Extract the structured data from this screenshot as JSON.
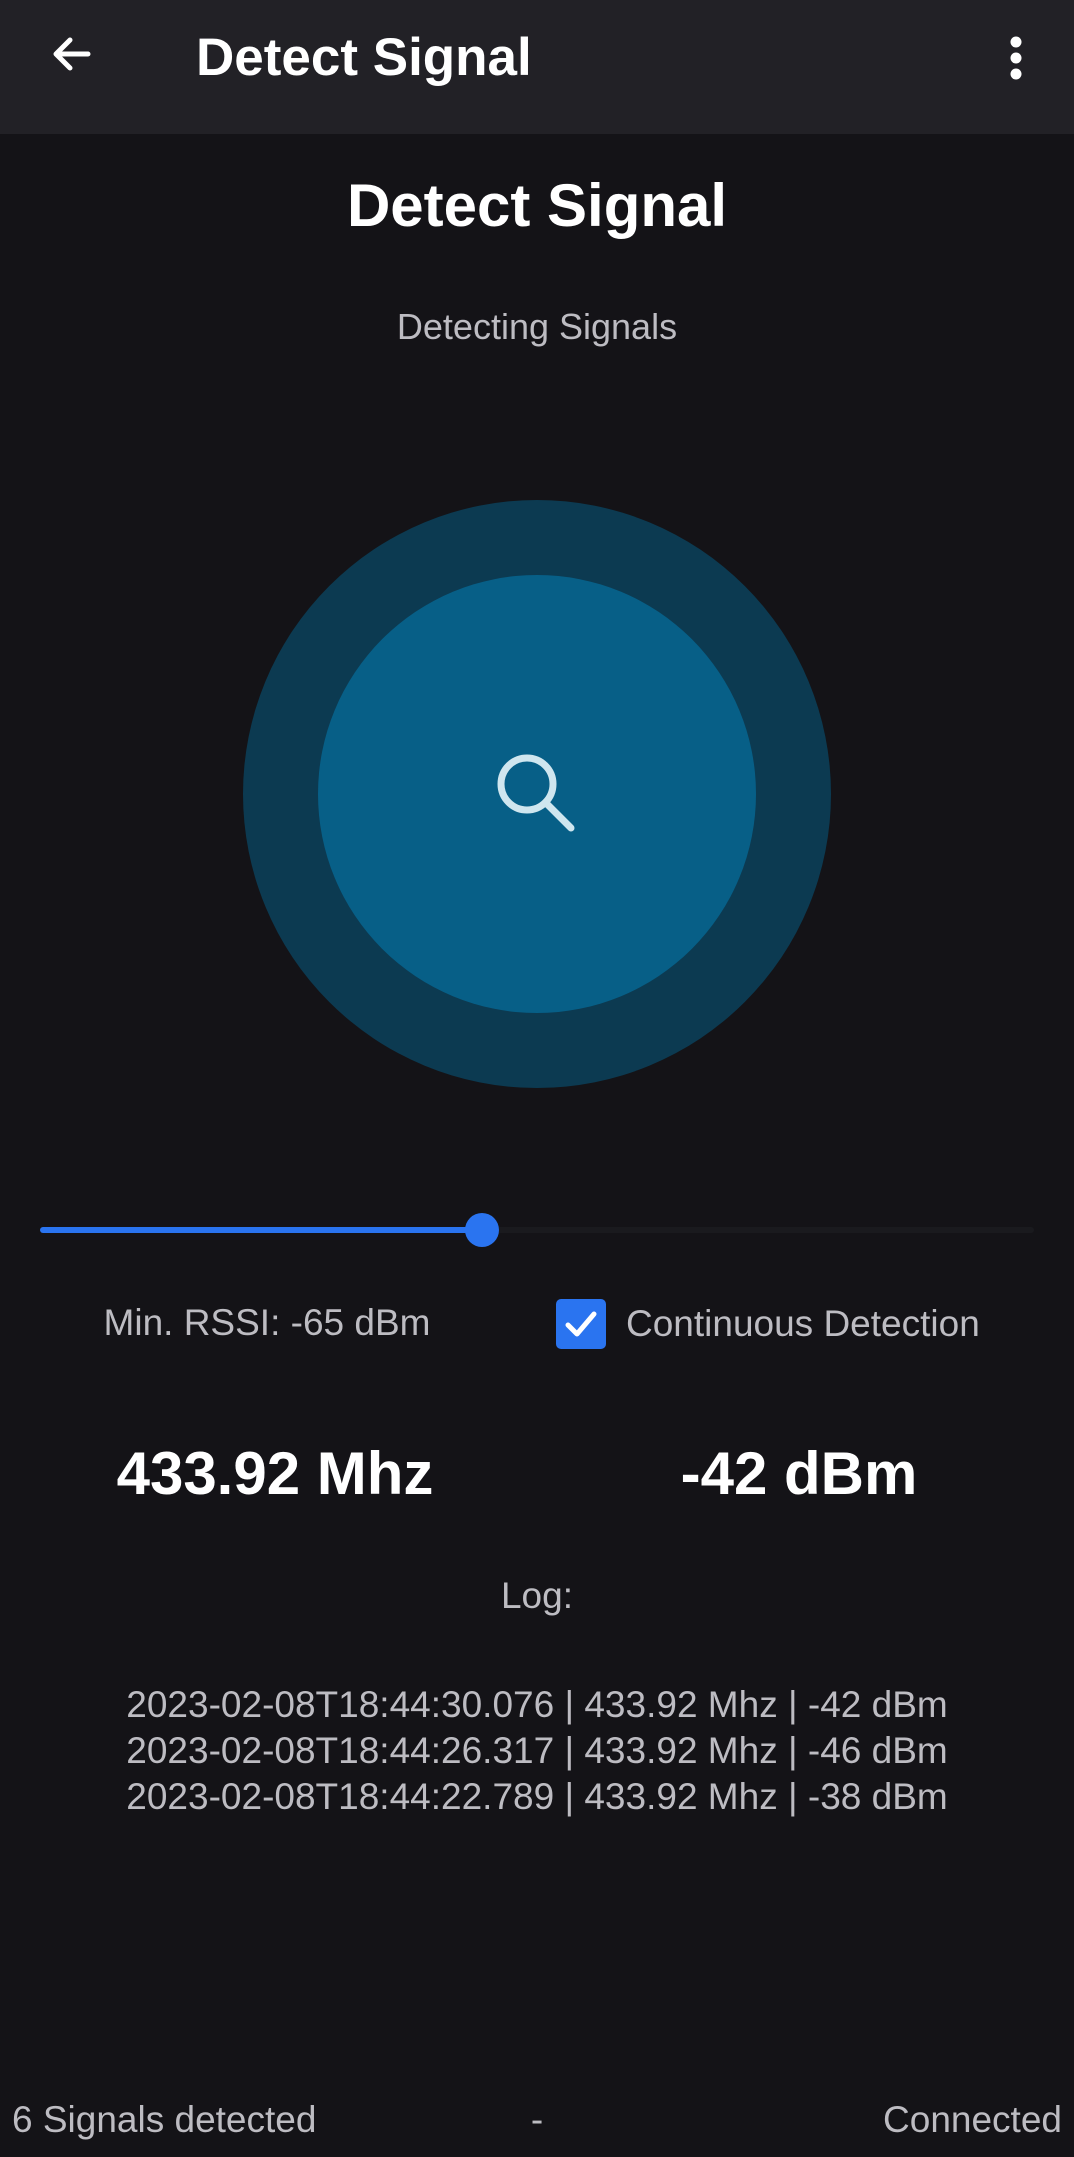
{
  "app_bar": {
    "title": "Detect Signal",
    "back_icon": "arrow-left-icon",
    "menu_icon": "more-vertical-icon"
  },
  "main": {
    "title": "Detect Signal",
    "status": "Detecting Signals",
    "scan_icon": "search-icon",
    "slider_fraction": 0.445,
    "min_rssi_label": "Min. RSSI: -65 dBm",
    "continuous_detection": {
      "label": "Continuous Detection",
      "checked": true
    },
    "frequency": "433.92 Mhz",
    "rssi": "-42 dBm",
    "log_label": "Log:",
    "log_entries": [
      "2023-02-08T18:44:30.076 | 433.92 Mhz | -42 dBm",
      "2023-02-08T18:44:26.317 | 433.92 Mhz | -46 dBm",
      "2023-02-08T18:44:22.789 | 433.92 Mhz | -38 dBm"
    ]
  },
  "footer": {
    "signals": "6 Signals detected",
    "separator": "-",
    "connection": "Connected"
  },
  "colors": {
    "background": "#141317",
    "app_bar": "#222126",
    "accent": "#2a74f0",
    "outer_circle": "#0c3a51",
    "inner_circle": "#075f87",
    "secondary_text": "#bdbcc2"
  }
}
